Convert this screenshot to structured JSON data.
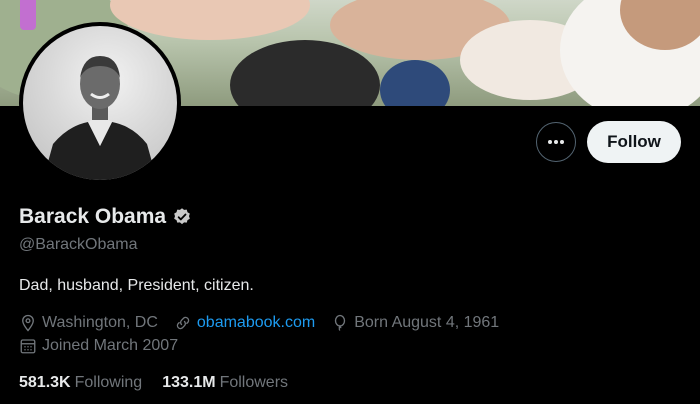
{
  "profile": {
    "name": "Barack Obama",
    "handle": "@BarackObama",
    "bio": "Dad, husband, President, citizen.",
    "location": "Washington, DC",
    "website": "obamabook.com",
    "birthday": "Born August 4, 1961",
    "joined": "Joined March 2007",
    "verified_icon": "verified-badge-icon"
  },
  "actions": {
    "follow_label": "Follow",
    "more_icon": "more-icon"
  },
  "stats": {
    "following_count": "581.3K",
    "following_label": "Following",
    "followers_count": "133.1M",
    "followers_label": "Followers"
  },
  "colors": {
    "background": "#000000",
    "primary_text": "#e7e9ea",
    "secondary_text": "#71767b",
    "link": "#1d9bf0",
    "follow_button": "#eff3f4"
  }
}
